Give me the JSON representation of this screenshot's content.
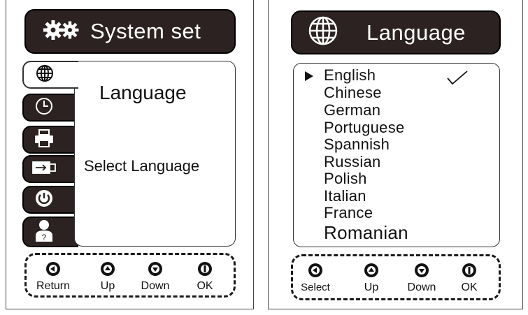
{
  "system_screen": {
    "title": "System set",
    "active_tab": "language",
    "tabs": [
      {
        "id": "language",
        "icon": "globe-icon"
      },
      {
        "id": "time",
        "icon": "clock-icon"
      },
      {
        "id": "printer",
        "icon": "printer-icon"
      },
      {
        "id": "usb",
        "icon": "usb-icon"
      },
      {
        "id": "power",
        "icon": "power-icon"
      },
      {
        "id": "user-help",
        "icon": "user-help-icon"
      }
    ],
    "menu_title": "Language",
    "menu_description": "Select Language",
    "keys": [
      "Return",
      "Up",
      "Down",
      "OK"
    ]
  },
  "language_screen": {
    "title": "Language",
    "languages": [
      "English",
      "Chinese",
      "German",
      "Portuguese",
      "Spannish",
      "Russian",
      "Polish",
      "Italian",
      "France",
      "Romanian"
    ],
    "selected": "English",
    "keys": [
      "Select",
      "Up",
      "Down",
      "OK"
    ]
  }
}
